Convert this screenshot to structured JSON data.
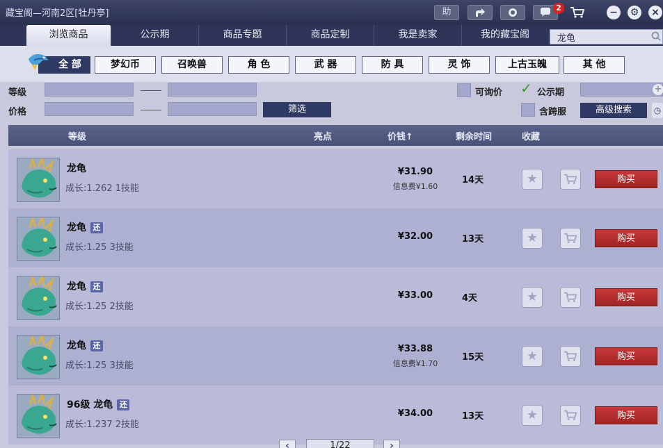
{
  "window": {
    "title": "藏宝阁—河南2区[牡丹亭]",
    "help_label": "助",
    "message_count": "2"
  },
  "nav": {
    "tabs": [
      "浏览商品",
      "公示期",
      "商品专题",
      "商品定制",
      "我是卖家",
      "我的藏宝阁"
    ],
    "search_value": "龙龟"
  },
  "categories": [
    "全 部",
    "梦幻币",
    "召唤兽",
    "角 色",
    "武 器",
    "防 具",
    "灵 饰",
    "上古玉魄",
    "其 他"
  ],
  "filters": {
    "level_label": "等级",
    "price_label": "价格",
    "filter_button": "筛选",
    "inquiry_label": "可询价",
    "public_label": "公示期",
    "cross_server_label": "含跨服",
    "advanced_button": "高级搜索"
  },
  "table": {
    "headers": {
      "level": "等级",
      "highlight": "亮点",
      "price": "价钱↑",
      "remain": "剩余时间",
      "favorite": "收藏"
    },
    "buy_label": "购买",
    "return_tag": "还",
    "rows": [
      {
        "name": "龙龟",
        "has_tag": false,
        "detail": "成长:1.262 1技能",
        "price": "¥31.90",
        "fee": "信息费¥1.60",
        "remain": "14天"
      },
      {
        "name": "龙龟",
        "has_tag": true,
        "detail": "成长:1.25 3技能",
        "price": "¥32.00",
        "fee": "",
        "remain": "13天"
      },
      {
        "name": "龙龟",
        "has_tag": true,
        "detail": "成长:1.25 2技能",
        "price": "¥33.00",
        "fee": "",
        "remain": "4天"
      },
      {
        "name": "龙龟",
        "has_tag": true,
        "detail": "成长:1.25 3技能",
        "price": "¥33.88",
        "fee": "信息费¥1.70",
        "remain": "15天"
      },
      {
        "name": "96级 龙龟",
        "has_tag": true,
        "detail": "成长:1.237 2技能",
        "price": "¥34.00",
        "fee": "",
        "remain": "13天"
      }
    ]
  },
  "pager": {
    "page_text": "1/22"
  },
  "colors": {
    "accent": "#2f3a64",
    "buy": "#b02c2c",
    "row_odd": "#b9bbd8",
    "row_even": "#aeb0d2"
  }
}
